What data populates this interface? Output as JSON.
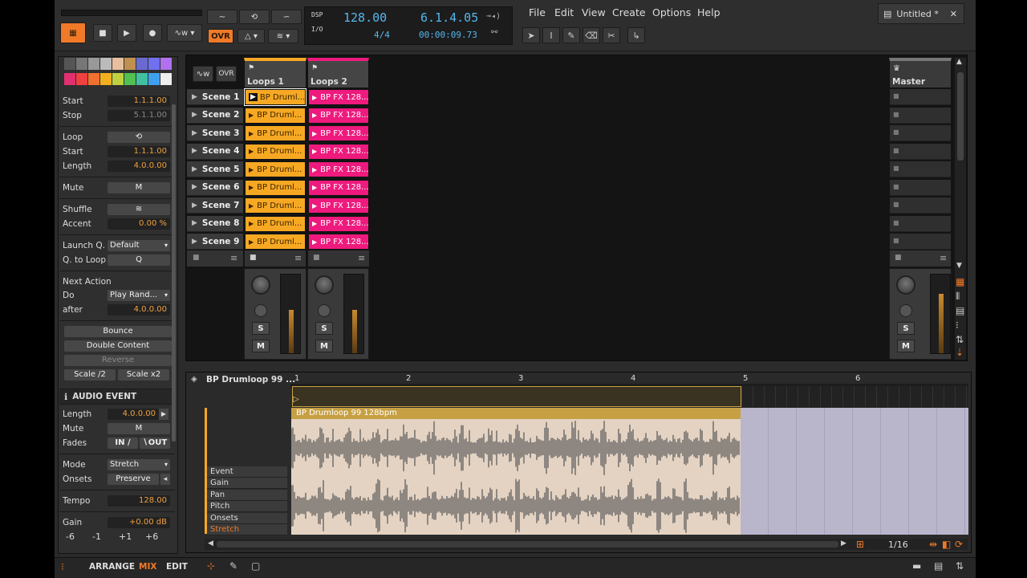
{
  "transport": {
    "tempo": "128.00",
    "time_signature": "4/4",
    "position": "6.1.4.05",
    "time": "00:00:09.73",
    "dsp_label": "DSP",
    "io_label": "I/O",
    "ovr_label": "OVR"
  },
  "menu": [
    "File",
    "Edit",
    "View",
    "Create",
    "Options",
    "Help"
  ],
  "document": {
    "tab_title": "Untitled *"
  },
  "inspector": {
    "start_label": "Start",
    "start": "1.1.1.00",
    "stop_label": "Stop",
    "stop": "5.1.1.00",
    "loop_label": "Loop",
    "loop_start_label": "Start",
    "loop_start": "1.1.1.00",
    "length_label": "Length",
    "length": "4.0.0.00",
    "mute_label": "Mute",
    "mute_btn": "M",
    "shuffle_label": "Shuffle",
    "accent_label": "Accent",
    "accent": "0.00 %",
    "launchq_label": "Launch Q.",
    "launchq": "Default",
    "qtoloop_label": "Q. to Loop",
    "qtoloop_btn": "Q",
    "next_action_label": "Next Action",
    "do_label": "Do",
    "do": "Play Rand...",
    "after_label": "after",
    "after": "4.0.0.00",
    "bounce": "Bounce",
    "double": "Double Content",
    "reverse": "Reverse",
    "scale_half": "Scale /2",
    "scale_double": "Scale x2",
    "audio_event_header": "AUDIO EVENT",
    "ae_length_label": "Length",
    "ae_length": "4.0.0.00",
    "ae_mute_label": "Mute",
    "ae_mute_btn": "M",
    "fades_label": "Fades",
    "fade_in": "IN",
    "fade_out": "OUT",
    "mode_label": "Mode",
    "mode": "Stretch",
    "onsets_label": "Onsets",
    "onsets": "Preserve",
    "tempo_label": "Tempo",
    "tempo": "128.00",
    "gain_label": "Gain",
    "gain": "+0.00 dB",
    "gain_steps": [
      "-6",
      "-1",
      "+1",
      "+6"
    ]
  },
  "launcher": {
    "ovr": "OVR",
    "tracks": [
      {
        "name": "Loops 1"
      },
      {
        "name": "Loops 2"
      }
    ],
    "master": "Master",
    "scenes": [
      "Scene 1",
      "Scene 2",
      "Scene 3",
      "Scene 4",
      "Scene 5",
      "Scene 6",
      "Scene 7",
      "Scene 8",
      "Scene 9"
    ],
    "clip_a": "BP Druml...",
    "clip_b": "BP FX 128...",
    "solo": "S",
    "mute": "M"
  },
  "detail": {
    "clip_name": "BP Drumloop 99 ...",
    "event_name": "BP Drumloop 99 128bpm",
    "ruler": [
      "1",
      "2",
      "3",
      "4",
      "5",
      "6"
    ],
    "lanes": [
      "Event",
      "Gain",
      "Pan",
      "Pitch",
      "Onsets",
      "Stretch"
    ],
    "grid": "1/16"
  },
  "footer": {
    "arrange": "ARRANGE",
    "mix": "MIX",
    "edit": "EDIT"
  },
  "colors": {
    "accent": "#f07a28",
    "track1": "#f7a823",
    "track2": "#ee1a7d",
    "lcd": "#55b7f0"
  }
}
